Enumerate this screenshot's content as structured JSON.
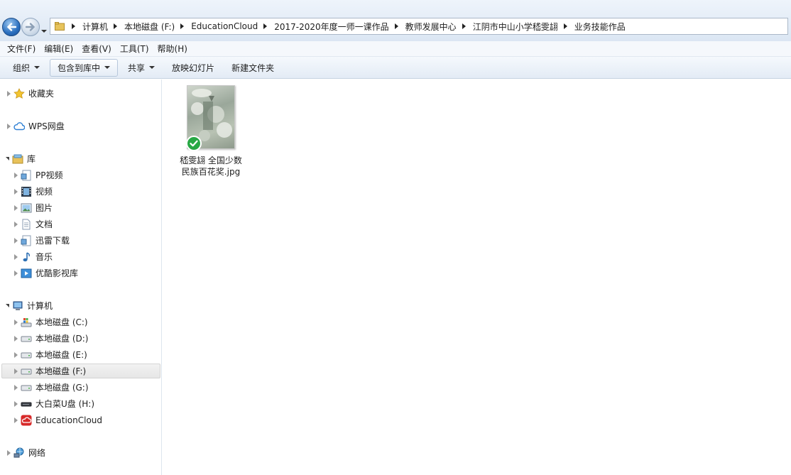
{
  "address": {
    "crumbs": [
      "计算机",
      "本地磁盘 (F:)",
      "EducationCloud",
      "2017-2020年度一师一课作品",
      "教师发展中心",
      "江阴市中山小学嵇雯翃",
      "业务技能作品"
    ]
  },
  "menubar": {
    "items": [
      "文件(F)",
      "编辑(E)",
      "查看(V)",
      "工具(T)",
      "帮助(H)"
    ]
  },
  "commandbar": {
    "organize": "组织",
    "include_in_library": "包含到库中",
    "share": "共享",
    "slideshow": "放映幻灯片",
    "new_folder": "新建文件夹"
  },
  "nav": {
    "favorites": "收藏夹",
    "wps": "WPS网盘",
    "library": "库",
    "lib_items": [
      "PP视频",
      "视频",
      "图片",
      "文档",
      "迅雷下载",
      "音乐",
      "优酷影视库"
    ],
    "computer": "计算机",
    "drives": [
      "本地磁盘 (C:)",
      "本地磁盘 (D:)",
      "本地磁盘 (E:)",
      "本地磁盘 (F:)",
      "本地磁盘 (G:)",
      "大白菜U盘 (H:)",
      "EducationCloud"
    ],
    "network": "网络"
  },
  "content": {
    "file_line1": "嵇雯翃 全国少数",
    "file_line2": "民族百花奖.jpg"
  }
}
